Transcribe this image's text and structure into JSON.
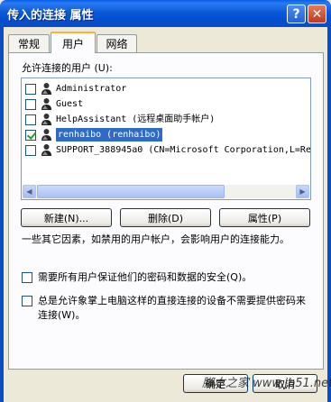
{
  "window": {
    "title": "传入的连接 属性",
    "help_glyph": "?",
    "close_glyph": "✕"
  },
  "tabs": [
    {
      "label": "常规"
    },
    {
      "label": "用户"
    },
    {
      "label": "网络"
    }
  ],
  "users_section": {
    "label": "允许连接的用户 (U):",
    "users": [
      {
        "name": "Administrator",
        "checked": false
      },
      {
        "name": "Guest",
        "checked": false
      },
      {
        "name": "HelpAssistant (远程桌面助手帐户)",
        "checked": false
      },
      {
        "name": "renhaibo (renhaibo)",
        "checked": true
      },
      {
        "name": "SUPPORT_388945a0 (CN=Microsoft Corporation,L=Re",
        "checked": false
      }
    ],
    "selected_index": 3
  },
  "buttons": {
    "add": "新建(N)...",
    "remove": "删除(D)",
    "properties": "属性(P)",
    "ok": "确定",
    "cancel": "取消"
  },
  "description": "一些其它因素，如禁用的用户帐户，会影响用户的连接能力。",
  "options": {
    "require_secure_password": "需要所有用户保证他们的密码和数据的安全(Q)。",
    "allow_direct_devices": "总是允许象掌上电脑这样的直接连接的设备不需要提供密码来连接(W)。"
  },
  "watermark": "脚本之家 www.jb51.net",
  "colors": {
    "titlebar": "#0350d0",
    "selection": "#316ac5",
    "dialog_bg": "#ece9d8"
  }
}
